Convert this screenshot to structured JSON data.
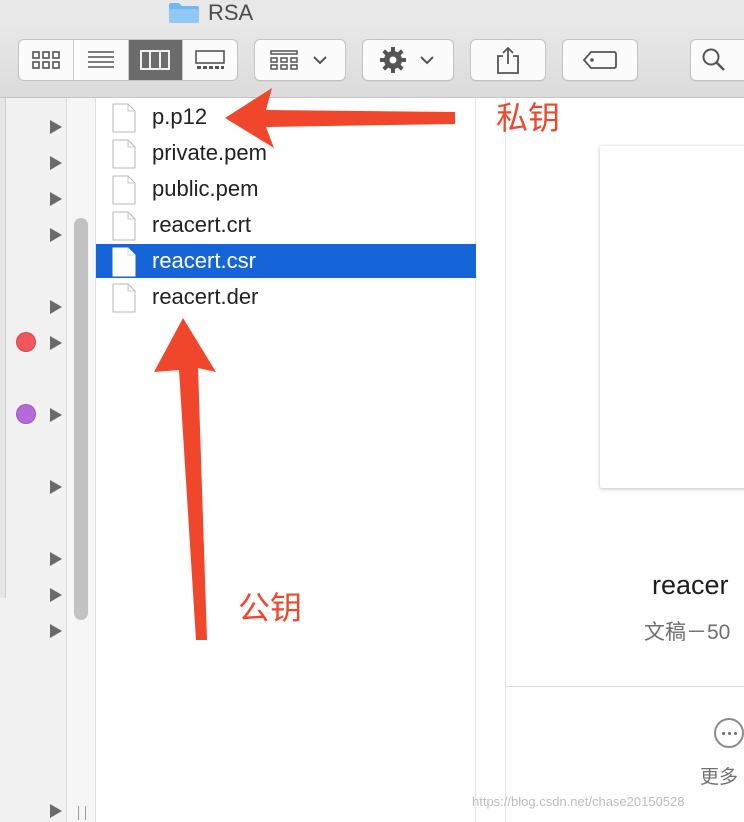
{
  "window": {
    "title": "RSA"
  },
  "toolbar": {
    "view_buttons": [
      "icon-view",
      "list-view",
      "column-view",
      "gallery-view"
    ],
    "active_view": 2
  },
  "sidebar": {
    "tag_colors": [
      "#f0565a",
      "#b56ad9"
    ]
  },
  "files": [
    {
      "name": "p.p12",
      "selected": false
    },
    {
      "name": "private.pem",
      "selected": false
    },
    {
      "name": "public.pem",
      "selected": false
    },
    {
      "name": "reacert.crt",
      "selected": false
    },
    {
      "name": "reacert.csr",
      "selected": true
    },
    {
      "name": "reacert.der",
      "selected": false
    }
  ],
  "preview": {
    "name": "reacer",
    "kind": "文稿－50",
    "more_label": "更多"
  },
  "annotations": {
    "private_key": "私钥",
    "public_key": "公钥",
    "color": "#f0472c"
  },
  "watermark": "https://blog.csdn.net/chase20150528",
  "colors": {
    "selection": "#1565d8"
  }
}
